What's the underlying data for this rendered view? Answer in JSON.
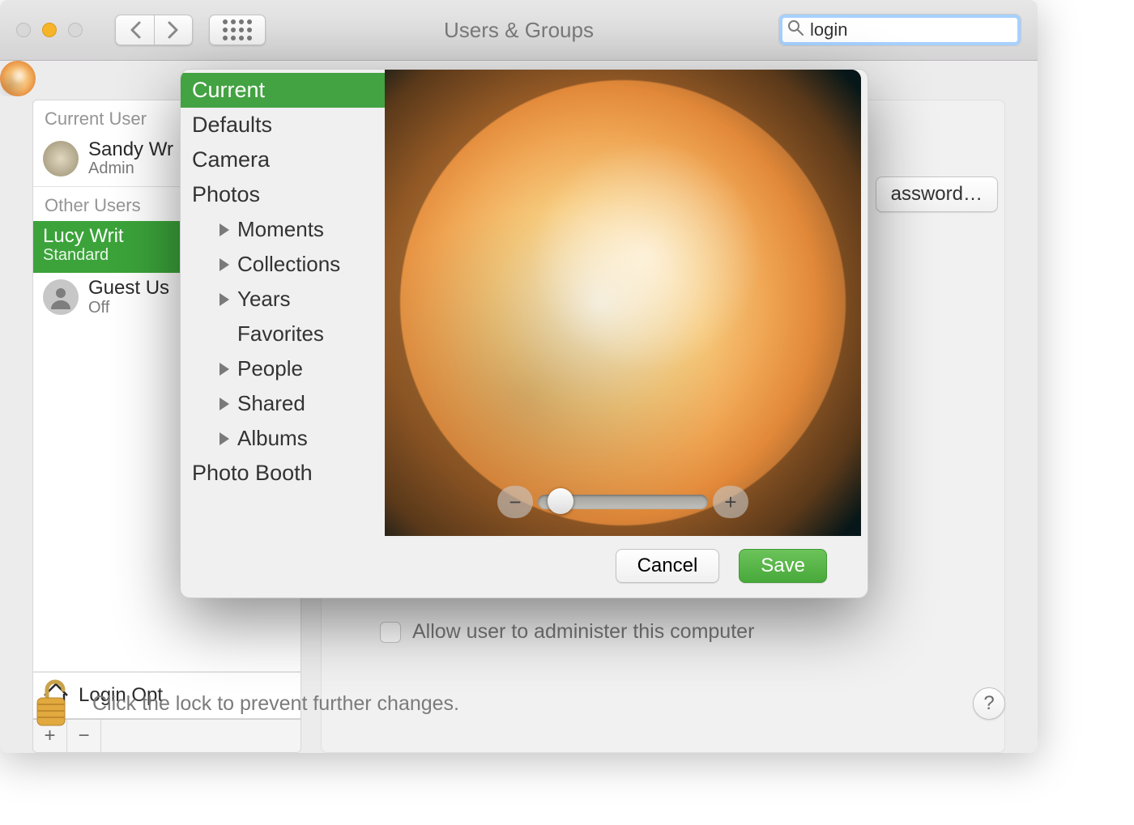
{
  "toolbar": {
    "title": "Users & Groups",
    "search_value": "login"
  },
  "sidebar": {
    "current_label": "Current User",
    "other_label": "Other Users",
    "users": [
      {
        "name": "Sandy Wr",
        "role": "Admin"
      },
      {
        "name": "Lucy Writ",
        "role": "Standard"
      },
      {
        "name": "Guest Us",
        "role": "Off"
      }
    ],
    "login_options": "Login Opt"
  },
  "rightpanel": {
    "password_button": "assword…",
    "allow_admin": "Allow user to administer this computer"
  },
  "popover": {
    "categories": [
      {
        "label": "Current",
        "selected": true
      },
      {
        "label": "Defaults"
      },
      {
        "label": "Camera"
      },
      {
        "label": "Photos"
      },
      {
        "label": "Moments",
        "sub": true,
        "expandable": true
      },
      {
        "label": "Collections",
        "sub": true,
        "expandable": true
      },
      {
        "label": "Years",
        "sub": true,
        "expandable": true
      },
      {
        "label": "Favorites",
        "sub": true
      },
      {
        "label": "People",
        "sub": true,
        "expandable": true
      },
      {
        "label": "Shared",
        "sub": true,
        "expandable": true
      },
      {
        "label": "Albums",
        "sub": true,
        "expandable": true
      },
      {
        "label": "Photo Booth"
      }
    ],
    "cancel": "Cancel",
    "save": "Save"
  },
  "footer": {
    "text": "Click the lock to prevent further changes."
  }
}
